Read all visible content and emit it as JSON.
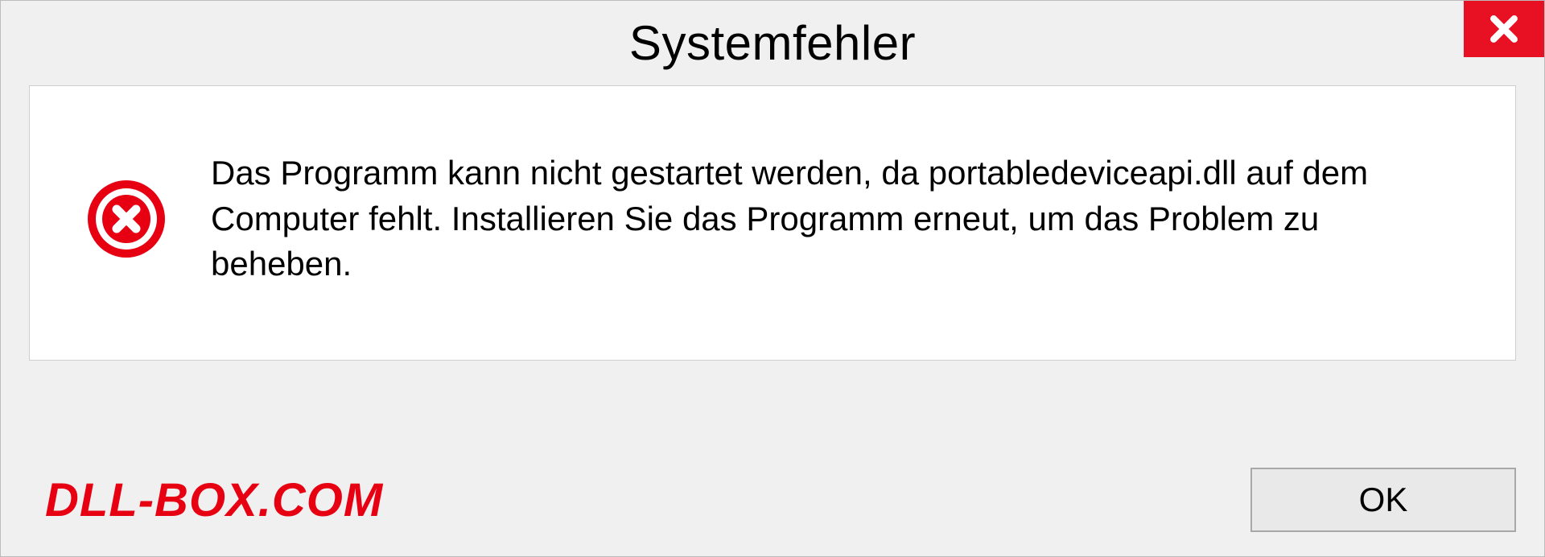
{
  "dialog": {
    "title": "Systemfehler",
    "message": "Das Programm kann nicht gestartet werden, da portabledeviceapi.dll auf dem Computer fehlt. Installieren Sie das Programm erneut, um das Problem zu beheben.",
    "ok_label": "OK"
  },
  "watermark": "DLL-BOX.COM",
  "colors": {
    "close_bg": "#e81123",
    "error_icon": "#e60012",
    "watermark": "#e60012"
  }
}
